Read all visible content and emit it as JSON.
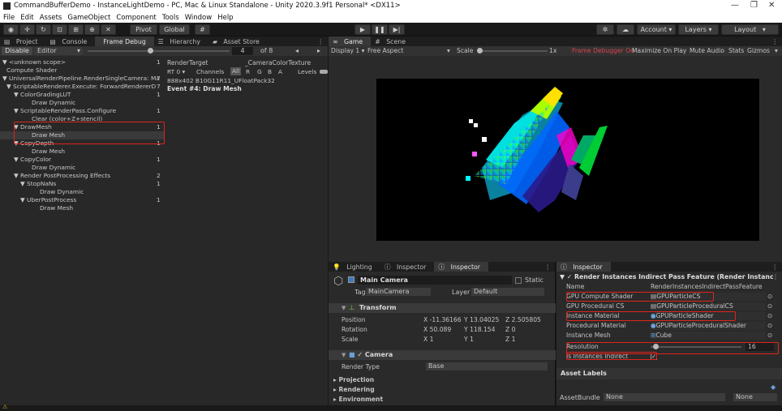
{
  "titlebar": {
    "title": "CommandBufferDemo - InstanceLightDemo - PC, Mac & Linux Standalone - Unity 2020.3.9f1 Personal* <DX11>"
  },
  "menu": [
    "File",
    "Edit",
    "Assets",
    "GameObject",
    "Component",
    "Tools",
    "Window",
    "Help"
  ],
  "toolbar": {
    "pivot": "Pivot",
    "global": "Global",
    "account": "Account",
    "layers": "Layers",
    "layout": "Layout"
  },
  "left_tabs": [
    "Project",
    "Console",
    "Frame Debug",
    "Hierarchy",
    "Asset Store"
  ],
  "frame_debug": {
    "disable": "Disable",
    "editor": "Editor",
    "event_num": "4",
    "of_total": "of 8",
    "render_target_label": "RenderTarget",
    "render_target_value": "_CameraColorTexture",
    "rt": "RT 0",
    "channels": "Channels",
    "all": "All",
    "r": "R",
    "g": "G",
    "b": "B",
    "a": "A",
    "levels": "Levels",
    "info": "888x402 B10G11R11_UFloatPack32",
    "event": "Event #4: Draw Mesh"
  },
  "tree": [
    {
      "label": "▼ <unknown scope>",
      "count": "1"
    },
    {
      "label": "Compute Shader",
      "count": ""
    },
    {
      "label": "▼ UniversalRenderPipeline.RenderSingleCamera: Ma",
      "count": "7"
    },
    {
      "label": "▼ ScriptableRenderer.Execute: ForwardRendererD",
      "count": "7"
    },
    {
      "label": "▼ ColorGradingLUT",
      "count": "1"
    },
    {
      "label": "Draw Dynamic",
      "count": ""
    },
    {
      "label": "▼ ScriptableRenderPass.Configure",
      "count": "1"
    },
    {
      "label": "Clear (color+Z+stencil)",
      "count": ""
    },
    {
      "label": "▼ DrawMesh",
      "count": "1"
    },
    {
      "label": "Draw Mesh",
      "count": ""
    },
    {
      "label": "▼ CopyDepth",
      "count": "1"
    },
    {
      "label": "Draw Mesh",
      "count": ""
    },
    {
      "label": "▼ CopyColor",
      "count": "1"
    },
    {
      "label": "Draw Dynamic",
      "count": ""
    },
    {
      "label": "▼ Render PostProcessing Effects",
      "count": "2"
    },
    {
      "label": "▼ StopNaNs",
      "count": "1"
    },
    {
      "label": "Draw Dynamic",
      "count": ""
    },
    {
      "label": "▼ UberPostProcess",
      "count": "1"
    },
    {
      "label": "Draw Mesh",
      "count": ""
    }
  ],
  "game": {
    "tabs": [
      "Game",
      "Scene"
    ],
    "display": "Display 1",
    "aspect": "Free Aspect",
    "scale_label": "Scale",
    "scale_value": "1x",
    "fd_on": "Frame Debugger On",
    "maximize": "Maximize On Play",
    "mute": "Mute Audio",
    "stats": "Stats",
    "gizmos": "Gizmos"
  },
  "inspector": {
    "tabs": [
      "Lighting",
      "Inspector",
      "Inspector"
    ],
    "object_name": "Main Camera",
    "static": "Static",
    "tag_label": "Tag",
    "tag": "MainCamera",
    "layer_label": "Layer",
    "layer": "Default",
    "transform": "Transform",
    "position": {
      "label": "Position",
      "x": "-11.36166",
      "y": "13.04025",
      "z": "2.505805"
    },
    "rotation": {
      "label": "Rotation",
      "x": "50.089",
      "y": "118.154",
      "z": "0"
    },
    "scale": {
      "label": "Scale",
      "x": "1",
      "y": "1",
      "z": "1"
    },
    "camera": "Camera",
    "render_type_label": "Render Type",
    "render_type": "Base",
    "sections": [
      "Projection",
      "Rendering",
      "Environment"
    ]
  },
  "inspector2": {
    "tab": "Inspector",
    "header": "Render Instances Indirect Pass Feature (Render Instanc",
    "rows": [
      {
        "label": "Name",
        "value": "RenderInstancesIndirectPassFeature",
        "icon": ""
      },
      {
        "label": "GPU Compute Shader",
        "value": "GPUParticleCS",
        "icon": "file"
      },
      {
        "label": "GPU Procedural CS",
        "value": "GPUParticleProceduralCS",
        "icon": "file"
      },
      {
        "label": "Instance Material",
        "value": "GPUParticleShader",
        "icon": "mat"
      },
      {
        "label": "Procedural Material",
        "value": "GPUParticleProceduralShader",
        "icon": "mat"
      },
      {
        "label": "Instance Mesh",
        "value": "Cube",
        "icon": "mesh"
      }
    ],
    "resolution_label": "Resolution",
    "resolution_value": "16",
    "resolution_fraction": 0.05,
    "indirect_label": "Is Instances Indirect",
    "asset_labels": "Asset Labels",
    "assetbundle_label": "AssetBundle",
    "assetbundle": "None",
    "variant": "None"
  },
  "colors": {
    "highlight": "#e0241b",
    "accent": "#3a79bb",
    "fd_on": "#d9434e"
  }
}
